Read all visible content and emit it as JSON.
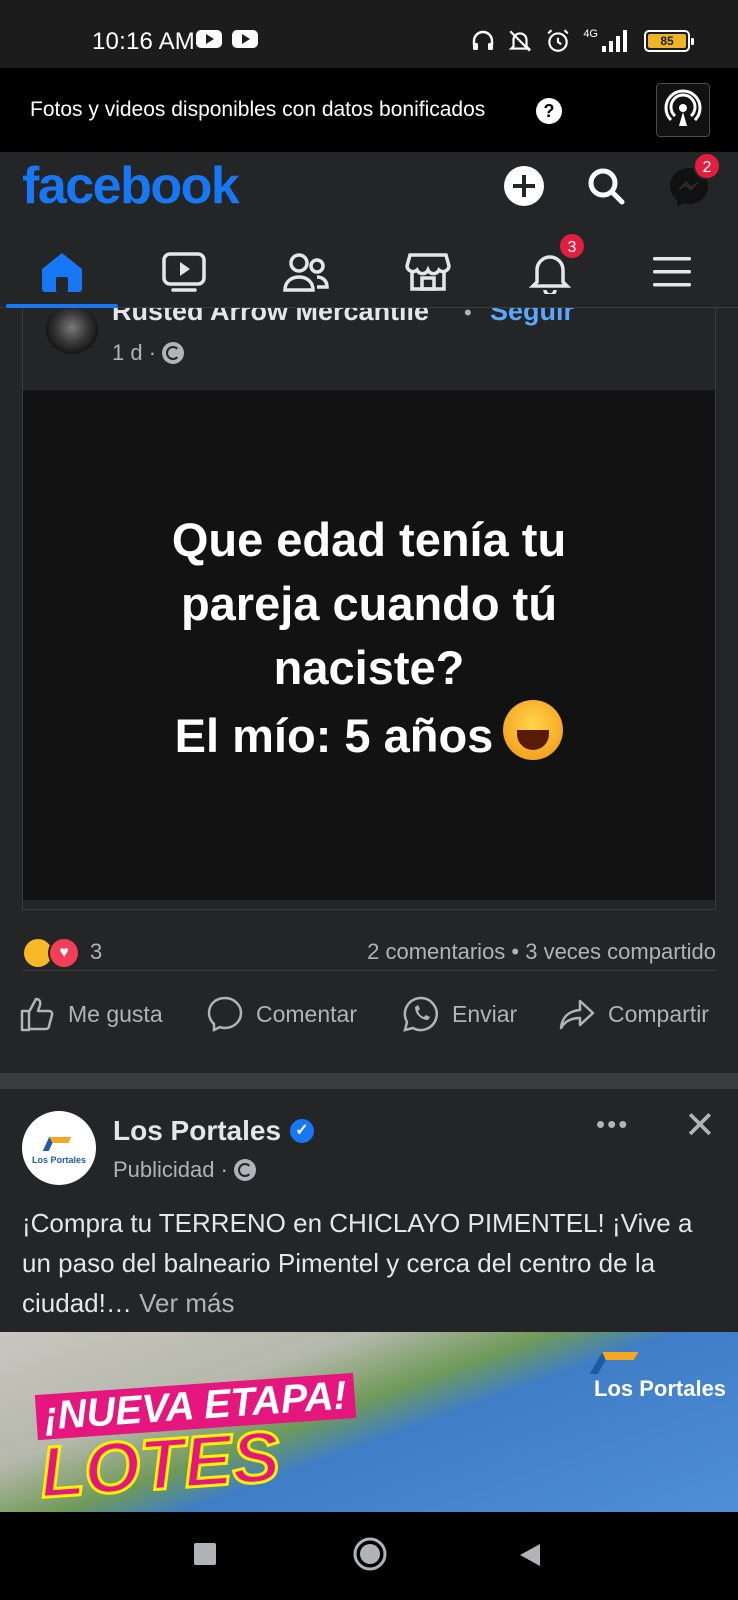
{
  "status_bar": {
    "time": "10:16 AM",
    "network": "4G",
    "battery": "85",
    "icons": [
      "youtube-icon",
      "youtube-icon",
      "headphones-icon",
      "bell-off-icon",
      "alarm-icon",
      "signal-icon",
      "battery-icon"
    ]
  },
  "data_banner": {
    "text": "Fotos y videos disponibles con datos bonificados",
    "help": "?"
  },
  "header": {
    "logo": "facebook",
    "messenger_badge": "2",
    "notifications_badge": "3",
    "nav_tabs": [
      "home",
      "watch",
      "friends",
      "marketplace",
      "notifications",
      "menu"
    ],
    "accent_color": "#1877f2"
  },
  "post1": {
    "author": "Rusted Arrow Mercantile",
    "separator": "•",
    "follow": "Seguir",
    "time": "1 d ·",
    "image_text_lines": [
      "Que edad tenía tu",
      "pareja cuando tú",
      "naciste?",
      "El mío: 5 años"
    ],
    "reaction_count": "3",
    "stats": "2 comentarios • 3 veces compartido",
    "actions": {
      "like": "Me gusta",
      "comment": "Comentar",
      "send": "Enviar",
      "share": "Compartir"
    }
  },
  "post2": {
    "author": "Los Portales",
    "avatar_text": "Los Portales",
    "meta": "Publicidad ·",
    "more": "•••",
    "close": "✕",
    "text_main": "¡Compra tu TERRENO en CHICLAYO PIMENTEL! ¡Vive a un paso del balneario Pimentel y cerca del centro de la ciudad!… ",
    "see_more": "Ver más",
    "ad_headline1": "¡NUEVA ETAPA!",
    "ad_headline2": "LOTES",
    "ad_brand": "Los Portales"
  }
}
